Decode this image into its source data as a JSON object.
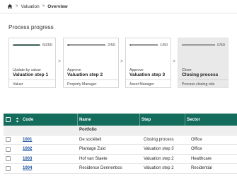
{
  "breadcrumb": {
    "home_icon": "home-icon",
    "separator": ">",
    "items": [
      "Valuation",
      "Overview"
    ]
  },
  "section": {
    "title": "Process progress"
  },
  "colors": {
    "accent": "#136c5c",
    "header_text": "#ffffff",
    "link": "#1a4f9c",
    "closed_card": "#e9e9e9"
  },
  "steps": [
    {
      "progress": 1.0,
      "count": "50/50",
      "caption": "Update by valuer",
      "name": "Valuation step 1",
      "role": "Valuer"
    },
    {
      "progress": 0.04,
      "count": "2/50",
      "caption": "Approve",
      "name": "Valuation step 2",
      "role": "Property Manager"
    },
    {
      "progress": 0.02,
      "count": "1/50",
      "caption": "Approve",
      "name": "Valuation step 3",
      "role": "Asset Manager"
    },
    {
      "progress": 0.0,
      "count": "0/50",
      "caption": "Close",
      "name": "Closing process",
      "role": "Process closing role"
    }
  ],
  "table": {
    "headers": {
      "code": "Code",
      "name": "Name",
      "step": "Step",
      "sector": "Sector"
    },
    "group_label": "Portfolio",
    "rows": [
      {
        "code": "1001",
        "name": "De sociëteit",
        "step": "Closing process",
        "sector": "Office"
      },
      {
        "code": "1002",
        "name": "Plantage Zuid",
        "step": "Valuation step 3",
        "sector": "Office"
      },
      {
        "code": "1003",
        "name": "Hof van Staete",
        "step": "Valuation step 2",
        "sector": "Healthcare"
      },
      {
        "code": "1004",
        "name": "Residence Dennenbos",
        "step": "Valuation step 2",
        "sector": "Residential"
      }
    ]
  }
}
